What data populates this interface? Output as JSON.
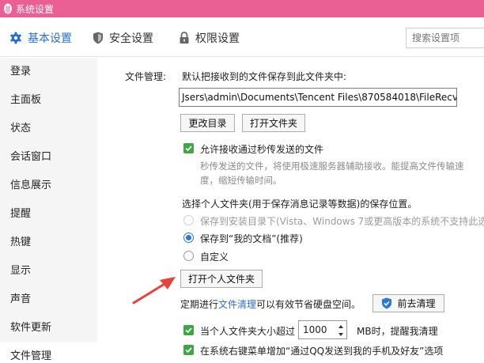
{
  "window": {
    "title": "系统设置"
  },
  "tabs": [
    {
      "label": "基本设置",
      "active": true
    },
    {
      "label": "安全设置",
      "active": false
    },
    {
      "label": "权限设置",
      "active": false
    }
  ],
  "search": {
    "placeholder": "搜索设置项"
  },
  "sidebar": {
    "items": [
      {
        "label": "登录"
      },
      {
        "label": "主面板"
      },
      {
        "label": "状态"
      },
      {
        "label": "会话窗口"
      },
      {
        "label": "信息展示"
      },
      {
        "label": "提醒"
      },
      {
        "label": "热键"
      },
      {
        "label": "显示"
      },
      {
        "label": "声音"
      },
      {
        "label": "软件更新"
      },
      {
        "label": "文件管理",
        "active": true
      }
    ]
  },
  "file_mgmt": {
    "section_label": "文件管理:",
    "save_desc": "默认把接收到的文件保存到此文件夹中:",
    "path": "Jsers\\admin\\Documents\\Tencent Files\\870584018\\FileRecv\\",
    "change_dir_button": "更改目录",
    "open_folder_button": "打开文件夹",
    "allow_instant_checkbox": "允许接收通过秒传发送的文件",
    "allow_instant_checked": true,
    "instant_desc_line1": "秒传发送的文件，将使用极速服务器辅助接收。能提高文件传输速",
    "instant_desc_line2": "度，缩短传输时间。",
    "personal_folder_title": "选择个人文件夹(用于保存消息记录等数据)的保存位置。",
    "radio_options": [
      {
        "label": "保存到安装目录下(Vista、Windows 7或更高版本的系统不支持此选",
        "selected": false,
        "disabled": true
      },
      {
        "label": "保存到“我的文档”(推荐)",
        "selected": true,
        "disabled": false
      },
      {
        "label": "自定义",
        "selected": false,
        "disabled": false
      }
    ],
    "open_personal_button": "打开个人文件夹",
    "cleanup_prefix": "定期进行",
    "cleanup_link": "文件清理",
    "cleanup_suffix": "可以有效节省硬盘空间。",
    "cleanup_button": "前去清理",
    "size_checkbox_prefix": "当个人文件夹大小超过",
    "size_value": "1000",
    "size_checkbox_suffix": "MB时，提醒我清理",
    "size_checked": true,
    "context_menu_checkbox": "在系统右键菜单增加“通过QQ发送到我的手机及好友”选项",
    "context_menu_checked": true
  },
  "colors": {
    "titlebar": "#ea5f94",
    "accent": "#2a6fce",
    "checkbox": "#3fa644",
    "arrow": "#e8423a"
  }
}
